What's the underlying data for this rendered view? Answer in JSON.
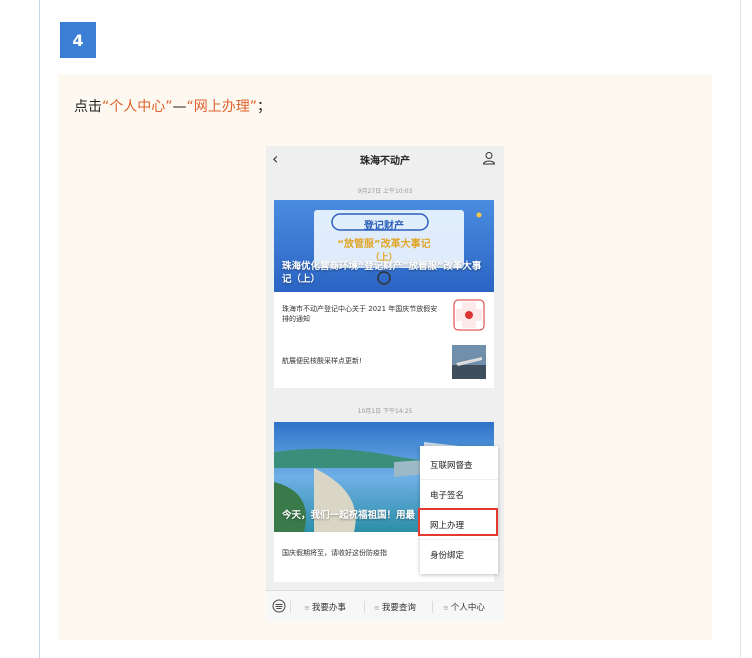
{
  "step": {
    "number": "4"
  },
  "instruction": {
    "prefix": "点击",
    "q1": "“个人中心”",
    "dash": "—",
    "q2": "“网上办理”",
    "suffix": "；"
  },
  "phone": {
    "title": "珠海不动产",
    "back_icon": "chevron-left-icon",
    "user_icon": "user-icon",
    "feed": [
      {
        "time": "9月27日 上午10:03",
        "hero_caption": "珠海优化营商环境“登记财产”放管服”改革大事记（上）",
        "banner_line1": "登记财产",
        "banner_line2": "“放管服”改革大事记",
        "banner_line3": "（上）",
        "items": [
          {
            "text": "珠海市不动产登记中心关于 2021 年国庆节放假安排的通知"
          },
          {
            "text": "航展便民核酸采样点更新!"
          }
        ]
      },
      {
        "time": "10月1日 下午14:25",
        "hero_caption": "今天，我们一起祝福祖国！用最",
        "items": [
          {
            "text": "国庆假期将至，请收好这份防疫指"
          }
        ]
      }
    ],
    "popup_menu": [
      "互联网督查",
      "电子签名",
      "网上办理",
      "身份绑定"
    ],
    "bottom_menu": [
      "我要办事",
      "我要查询",
      "个人中心"
    ],
    "keyboard_icon": "keyboard-icon"
  },
  "colors": {
    "accent": "#3a7fd5",
    "highlight_text": "#e0622e",
    "highlight_box": "#e23a2e",
    "panel_bg": "#fdf8f0"
  }
}
